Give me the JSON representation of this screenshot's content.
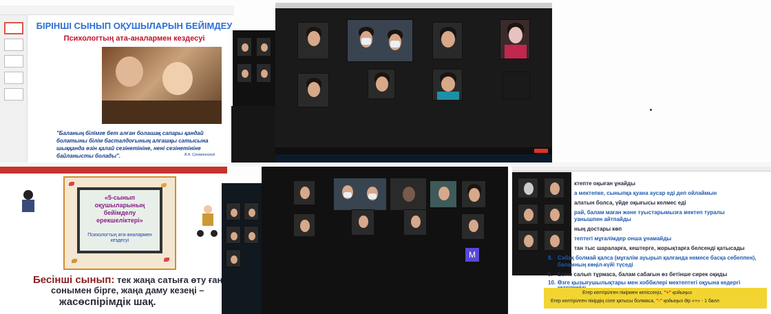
{
  "slide1": {
    "title": "БІРІНШІ СЫНЫП ОҚУШЫЛАРЫН БЕЙІМДЕУ",
    "subtitle": "Психологтың ата-аналармен кездесуі",
    "quote": "\"Баланың білімге бет алған болашақ сапары қандай болатыны білім басталдоғының алғашқы сатысына шыққанда өзін қалай сезінетініне, нені сезінетініне байланысты болады\".",
    "author": "В.А. Сухомлинский"
  },
  "slide2": {
    "board_title": "«5-сынып оқушыларының бейімделу ерекшеліктері»",
    "board_sub": "Психологтың ата-аналармен кездесуі",
    "line1_bold": "Бесінші сынып:",
    "line1_rest": " тек жаңа сатыға өту ғана е",
    "line2": "сонымен бірге, жаңа даму кезеңі –",
    "line3": "жасөспірімдік шақ."
  },
  "zoom": {
    "participant_button": "M"
  },
  "survey": {
    "items": [
      {
        "num": "",
        "text": "ктепте оқыған ұнайды"
      },
      {
        "num": "",
        "text": "а мектепке, сыныпқа қуана аусар еді деп ойлаймын"
      },
      {
        "num": "",
        "text": "алатын болса, үйде оқығысы келмес еді"
      },
      {
        "num": "",
        "text": "рай, балам маған және туыстарымызға мектеп туралы"
      },
      {
        "num": "",
        "text": "уанышпен айтпайды"
      },
      {
        "num": "",
        "text": "ның достары көп"
      },
      {
        "num": "",
        "text": "тептегі мұғалімдер онша ұнамайды"
      },
      {
        "num": "",
        "text": "тан тыс шараларға, кештерге, жорықтарға белсенді қатысады"
      },
      {
        "num": "8.",
        "text": "Сабақ болмай қалса (мұғалім ауырып қалғанда немесе басқа себеппен),"
      },
      {
        "num": "",
        "text": "баламның көңіл-күйі түседі"
      },
      {
        "num": "9.",
        "text": "Есіне салып тұрмаса, балам сабағын өз бетінше сирек оқиды"
      },
      {
        "num": "10.",
        "text": "Өзге қызығушылықтары мен хоббилері мектептегі оқуына кедергі"
      },
      {
        "num": "",
        "text": "келтірмейді"
      }
    ],
    "note1_pre": "Егер келтірілген пікірмен келіссеңіз, ",
    "note1_mark": "\"+\"",
    "note1_post": " қойыңыз",
    "note2_pre": "Егер келтірілген пікірдің сізге қатысы болмаса, ",
    "note2_mark": "\"-\"",
    "note2_post": " қойыңыз Әр «+» - 1 балл"
  }
}
